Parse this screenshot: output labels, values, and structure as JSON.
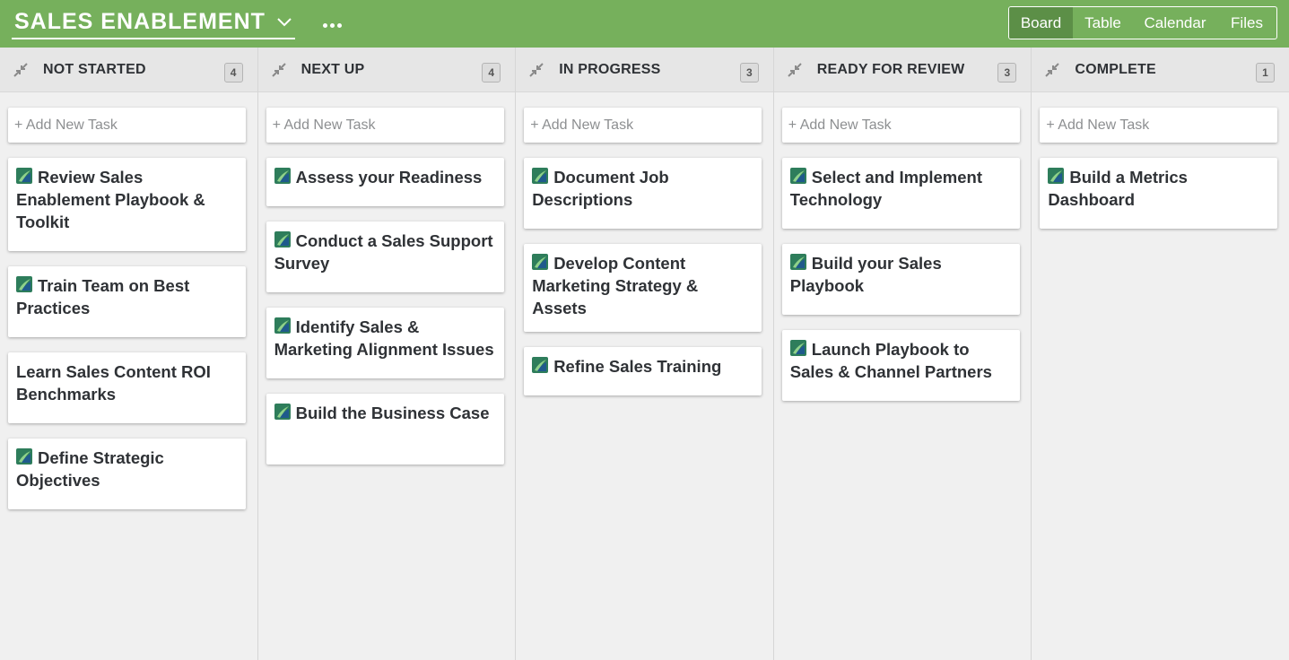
{
  "header": {
    "board_title": "SALES ENABLEMENT",
    "title_icon": "chevron-down-icon",
    "more_icon": "ellipsis-icon",
    "views": [
      {
        "label": "Board",
        "active": true
      },
      {
        "label": "Table",
        "active": false
      },
      {
        "label": "Calendar",
        "active": false
      },
      {
        "label": "Files",
        "active": false
      }
    ]
  },
  "theme": {
    "topbar": "#76b05c",
    "active_view": "#5c8f47",
    "text": "#2f3236",
    "placeholder": "#8d8f91"
  },
  "add_task_placeholder": "+ Add New Task",
  "columns": [
    {
      "name": "NOT STARTED",
      "count": "4",
      "tasks": [
        {
          "title": "Review Sales Enablement Playbook & Toolkit",
          "has_icon": true
        },
        {
          "title": "Train Team on Best Practices",
          "has_icon": true
        },
        {
          "title": "Learn Sales Content ROI Benchmarks",
          "has_icon": false
        },
        {
          "title": "Define Strategic Objectives",
          "has_icon": true
        }
      ]
    },
    {
      "name": "NEXT UP",
      "count": "4",
      "tasks": [
        {
          "title": "Assess your Readiness",
          "has_icon": true
        },
        {
          "title": "Conduct a Sales Support Survey",
          "has_icon": true
        },
        {
          "title": "Identify Sales & Marketing Alignment Issues",
          "has_icon": true
        },
        {
          "title": "Build the Business Case",
          "has_icon": true
        }
      ]
    },
    {
      "name": "IN PROGRESS",
      "count": "3",
      "tasks": [
        {
          "title": "Document Job Descriptions",
          "has_icon": true
        },
        {
          "title": "Develop Content Marketing Strategy & Assets",
          "has_icon": true
        },
        {
          "title": "Refine Sales Training",
          "has_icon": true
        }
      ]
    },
    {
      "name": "READY FOR REVIEW",
      "count": "3",
      "tasks": [
        {
          "title": "Select and Implement Technology",
          "has_icon": true
        },
        {
          "title": "Build your Sales Playbook",
          "has_icon": true
        },
        {
          "title": "Launch Playbook to Sales & Channel Partners",
          "has_icon": true
        }
      ]
    },
    {
      "name": "COMPLETE",
      "count": "1",
      "tasks": [
        {
          "title": "Build a Metrics Dashboard",
          "has_icon": true
        }
      ]
    }
  ]
}
